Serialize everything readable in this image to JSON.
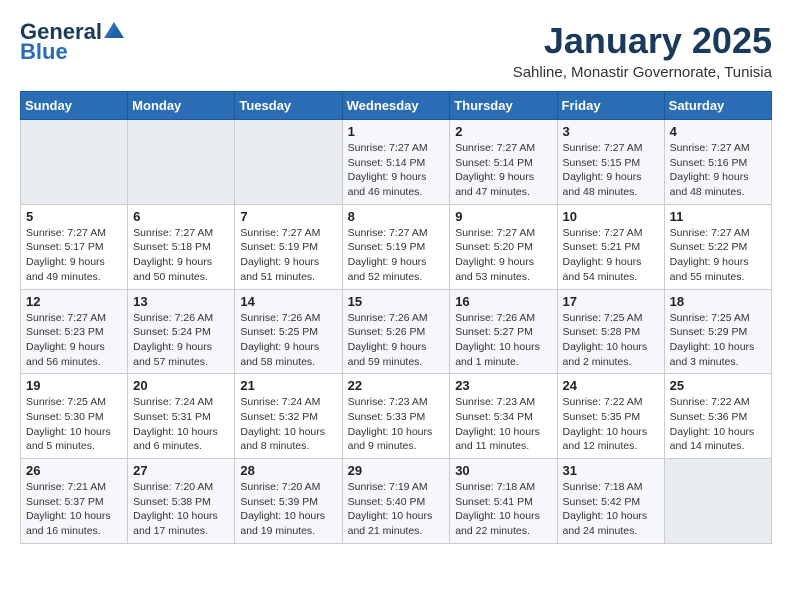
{
  "header": {
    "logo_line1": "General",
    "logo_line2": "Blue",
    "month": "January 2025",
    "location": "Sahline, Monastir Governorate, Tunisia"
  },
  "weekdays": [
    "Sunday",
    "Monday",
    "Tuesday",
    "Wednesday",
    "Thursday",
    "Friday",
    "Saturday"
  ],
  "weeks": [
    [
      {
        "day": "",
        "info": ""
      },
      {
        "day": "",
        "info": ""
      },
      {
        "day": "",
        "info": ""
      },
      {
        "day": "1",
        "info": "Sunrise: 7:27 AM\nSunset: 5:14 PM\nDaylight: 9 hours\nand 46 minutes."
      },
      {
        "day": "2",
        "info": "Sunrise: 7:27 AM\nSunset: 5:14 PM\nDaylight: 9 hours\nand 47 minutes."
      },
      {
        "day": "3",
        "info": "Sunrise: 7:27 AM\nSunset: 5:15 PM\nDaylight: 9 hours\nand 48 minutes."
      },
      {
        "day": "4",
        "info": "Sunrise: 7:27 AM\nSunset: 5:16 PM\nDaylight: 9 hours\nand 48 minutes."
      }
    ],
    [
      {
        "day": "5",
        "info": "Sunrise: 7:27 AM\nSunset: 5:17 PM\nDaylight: 9 hours\nand 49 minutes."
      },
      {
        "day": "6",
        "info": "Sunrise: 7:27 AM\nSunset: 5:18 PM\nDaylight: 9 hours\nand 50 minutes."
      },
      {
        "day": "7",
        "info": "Sunrise: 7:27 AM\nSunset: 5:19 PM\nDaylight: 9 hours\nand 51 minutes."
      },
      {
        "day": "8",
        "info": "Sunrise: 7:27 AM\nSunset: 5:19 PM\nDaylight: 9 hours\nand 52 minutes."
      },
      {
        "day": "9",
        "info": "Sunrise: 7:27 AM\nSunset: 5:20 PM\nDaylight: 9 hours\nand 53 minutes."
      },
      {
        "day": "10",
        "info": "Sunrise: 7:27 AM\nSunset: 5:21 PM\nDaylight: 9 hours\nand 54 minutes."
      },
      {
        "day": "11",
        "info": "Sunrise: 7:27 AM\nSunset: 5:22 PM\nDaylight: 9 hours\nand 55 minutes."
      }
    ],
    [
      {
        "day": "12",
        "info": "Sunrise: 7:27 AM\nSunset: 5:23 PM\nDaylight: 9 hours\nand 56 minutes."
      },
      {
        "day": "13",
        "info": "Sunrise: 7:26 AM\nSunset: 5:24 PM\nDaylight: 9 hours\nand 57 minutes."
      },
      {
        "day": "14",
        "info": "Sunrise: 7:26 AM\nSunset: 5:25 PM\nDaylight: 9 hours\nand 58 minutes."
      },
      {
        "day": "15",
        "info": "Sunrise: 7:26 AM\nSunset: 5:26 PM\nDaylight: 9 hours\nand 59 minutes."
      },
      {
        "day": "16",
        "info": "Sunrise: 7:26 AM\nSunset: 5:27 PM\nDaylight: 10 hours\nand 1 minute."
      },
      {
        "day": "17",
        "info": "Sunrise: 7:25 AM\nSunset: 5:28 PM\nDaylight: 10 hours\nand 2 minutes."
      },
      {
        "day": "18",
        "info": "Sunrise: 7:25 AM\nSunset: 5:29 PM\nDaylight: 10 hours\nand 3 minutes."
      }
    ],
    [
      {
        "day": "19",
        "info": "Sunrise: 7:25 AM\nSunset: 5:30 PM\nDaylight: 10 hours\nand 5 minutes."
      },
      {
        "day": "20",
        "info": "Sunrise: 7:24 AM\nSunset: 5:31 PM\nDaylight: 10 hours\nand 6 minutes."
      },
      {
        "day": "21",
        "info": "Sunrise: 7:24 AM\nSunset: 5:32 PM\nDaylight: 10 hours\nand 8 minutes."
      },
      {
        "day": "22",
        "info": "Sunrise: 7:23 AM\nSunset: 5:33 PM\nDaylight: 10 hours\nand 9 minutes."
      },
      {
        "day": "23",
        "info": "Sunrise: 7:23 AM\nSunset: 5:34 PM\nDaylight: 10 hours\nand 11 minutes."
      },
      {
        "day": "24",
        "info": "Sunrise: 7:22 AM\nSunset: 5:35 PM\nDaylight: 10 hours\nand 12 minutes."
      },
      {
        "day": "25",
        "info": "Sunrise: 7:22 AM\nSunset: 5:36 PM\nDaylight: 10 hours\nand 14 minutes."
      }
    ],
    [
      {
        "day": "26",
        "info": "Sunrise: 7:21 AM\nSunset: 5:37 PM\nDaylight: 10 hours\nand 16 minutes."
      },
      {
        "day": "27",
        "info": "Sunrise: 7:20 AM\nSunset: 5:38 PM\nDaylight: 10 hours\nand 17 minutes."
      },
      {
        "day": "28",
        "info": "Sunrise: 7:20 AM\nSunset: 5:39 PM\nDaylight: 10 hours\nand 19 minutes."
      },
      {
        "day": "29",
        "info": "Sunrise: 7:19 AM\nSunset: 5:40 PM\nDaylight: 10 hours\nand 21 minutes."
      },
      {
        "day": "30",
        "info": "Sunrise: 7:18 AM\nSunset: 5:41 PM\nDaylight: 10 hours\nand 22 minutes."
      },
      {
        "day": "31",
        "info": "Sunrise: 7:18 AM\nSunset: 5:42 PM\nDaylight: 10 hours\nand 24 minutes."
      },
      {
        "day": "",
        "info": ""
      }
    ]
  ]
}
